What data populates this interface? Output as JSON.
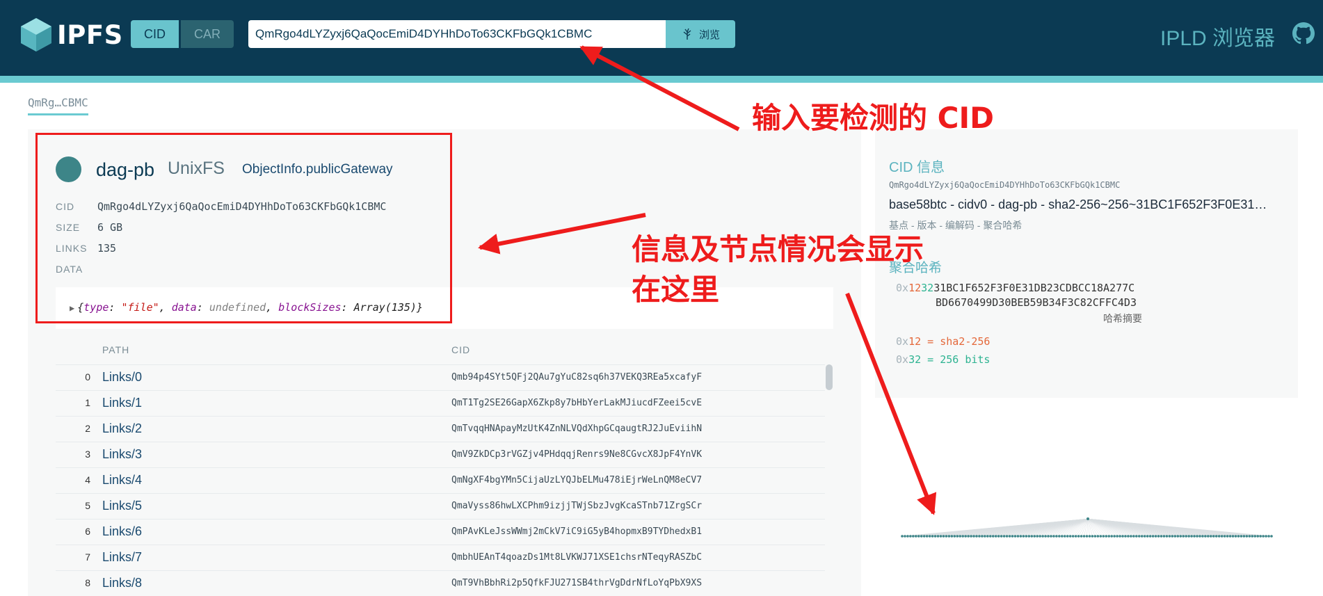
{
  "header": {
    "logo_text": "IPFS",
    "tab_cid": "CID",
    "tab_car": "CAR",
    "search_value": "QmRgo4dLYZyxj6QaQocEmiD4DYHhDoTo63CKFbGQk1CBMC",
    "browse_label": "浏览",
    "app_title": "IPLD 浏览器"
  },
  "breadcrumb": "QmRg…CBMC",
  "node": {
    "codec": "dag-pb",
    "format": "UnixFS",
    "public_gateway_label": "ObjectInfo.publicGateway",
    "meta": [
      {
        "label": "CID",
        "value": "QmRgo4dLYZyxj6QaQocEmiD4DYHhDoTo63CKFbGQk1CBMC"
      },
      {
        "label": "SIZE",
        "value": "6 GB"
      },
      {
        "label": "LINKS",
        "value": "135"
      },
      {
        "label": "DATA",
        "value": ""
      }
    ],
    "data_object": {
      "type_key": "type",
      "type_value": "\"file\"",
      "data_key": "data",
      "data_value": "undefined",
      "blocks_key": "blockSizes",
      "blocks_value": "Array(135)"
    }
  },
  "links_table": {
    "col_path": "PATH",
    "col_cid": "CID",
    "rows": [
      {
        "idx": "0",
        "path": "Links/0",
        "cid": "Qmb94p4SYt5QFj2QAu7gYuC82sq6h37VEKQ3REa5xcafyF"
      },
      {
        "idx": "1",
        "path": "Links/1",
        "cid": "QmT1Tg2SE26GapX6Zkp8y7bHbYerLakMJiucdFZeei5cvE"
      },
      {
        "idx": "2",
        "path": "Links/2",
        "cid": "QmTvqqHNApayMzUtK4ZnNLVQdXhpGCqaugtRJ2JuEviihN"
      },
      {
        "idx": "3",
        "path": "Links/3",
        "cid": "QmV9ZkDCp3rVGZjv4PHdqqjRenrs9Ne8CGvcX8JpF4YnVK"
      },
      {
        "idx": "4",
        "path": "Links/4",
        "cid": "QmNgXF4bgYMn5CijaUzLYQJbELMu478iEjrWeLnQM8eCV7"
      },
      {
        "idx": "5",
        "path": "Links/5",
        "cid": "QmaVyss86hwLXCPhm9izjjTWjSbzJvgKcaSTnb71ZrgSCr"
      },
      {
        "idx": "6",
        "path": "Links/6",
        "cid": "QmPAvKLeJssWWmj2mCkV7iC9iG5yB4hopmxB9TYDhedxB1"
      },
      {
        "idx": "7",
        "path": "Links/7",
        "cid": "QmbhUEAnT4qoazDs1Mt8LVKWJ71XSE1chsrNTeqyRASZbC"
      },
      {
        "idx": "8",
        "path": "Links/8",
        "cid": "QmT9VhBbhRi2p5QfkFJU271SB4thrVgDdrNfLoYqPbX9XS"
      }
    ]
  },
  "cid_info": {
    "heading": "CID 信息",
    "cid": "QmRgo4dLYZyxj6QaQocEmiD4DYHhDoTo63CKFbGQk1CBMC",
    "human_readable": "base58btc - cidv0 - dag-pb - sha2-256~256~31BC1F652F3F0E31…",
    "legend": "基点 - 版本 - 编解码 - 聚合哈希",
    "multihash_heading": "聚合哈希",
    "mh_prefix": "0x",
    "mh_code": "12",
    "mh_len": "32",
    "mh_line1_rest": "31BC1F652F3F0E31DB23CDBCC18A277C",
    "mh_line2": "BD6670499D30BEB59B34F3C82CFFC4D3",
    "digest_label": "哈希摘要",
    "codec_line_code": "12",
    "codec_line_name": "= sha2-256",
    "len_line_code": "32",
    "len_line_name": "= 256 bits"
  },
  "annotations": {
    "input_cid": "输入要检测的 CID",
    "info_here_line1": "信息及节点情况会显示",
    "info_here_line2": "在这里"
  },
  "colors": {
    "header_bg": "#0b3a53",
    "accent": "#69c4cd",
    "annotation_red": "#ee1c1c"
  }
}
